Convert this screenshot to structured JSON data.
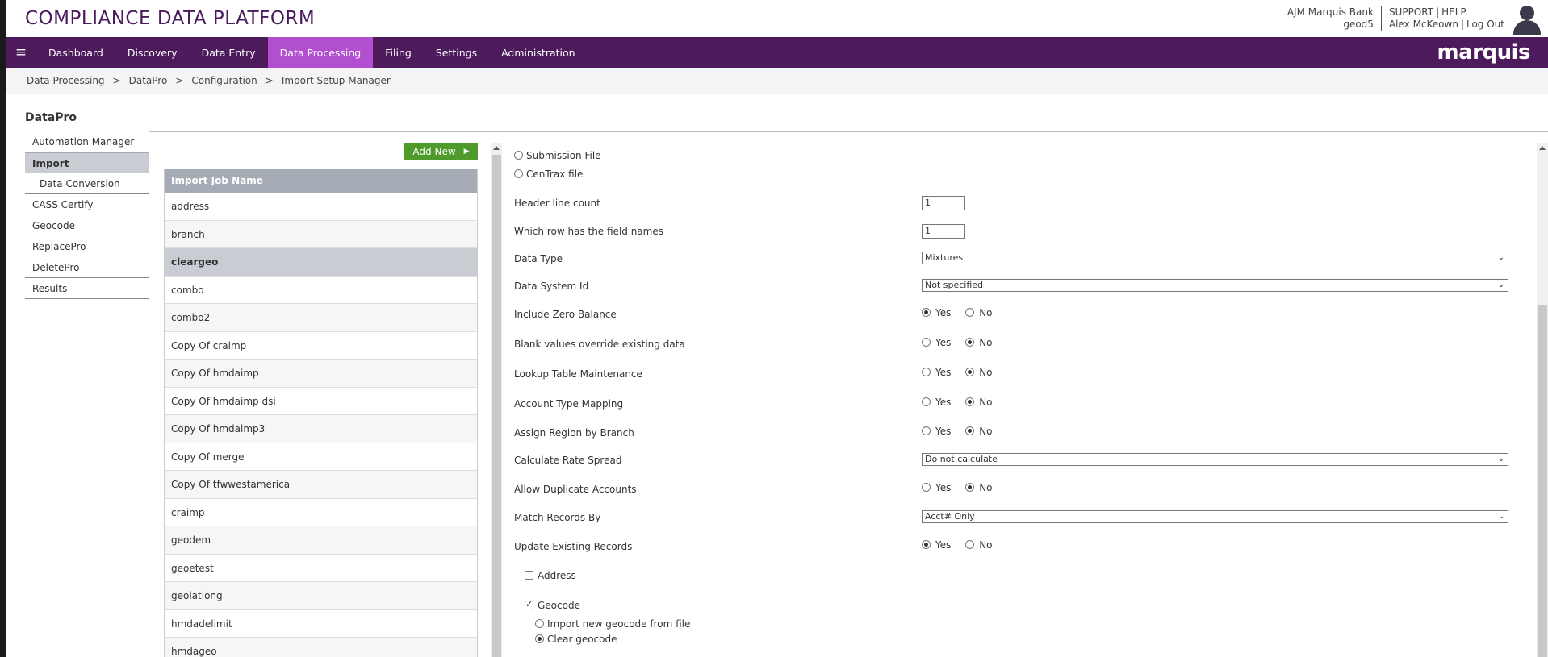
{
  "header": {
    "brand": "COMPLIANCE DATA PLATFORM",
    "bank_name": "AJM Marquis Bank",
    "user_code": "geod5",
    "support": "SUPPORT",
    "help": "HELP",
    "user_name": "Alex McKeown",
    "logout": "Log Out",
    "separator": "|"
  },
  "nav": {
    "menu_icon": "≡",
    "items": [
      "Dashboard",
      "Discovery",
      "Data Entry",
      "Data Processing",
      "Filing",
      "Settings",
      "Administration"
    ],
    "active": "Data Processing",
    "logo": "marquis"
  },
  "breadcrumb": {
    "items": [
      "Data Processing",
      "DataPro",
      "Configuration",
      "Import Setup Manager"
    ],
    "separator": ">"
  },
  "section_title": "DataPro",
  "side_menu": {
    "items": [
      "Automation Manager",
      "Import",
      "Data Conversion",
      "CASS Certify",
      "Geocode",
      "ReplacePro",
      "DeletePro",
      "Results"
    ],
    "active": "Import"
  },
  "job_list": {
    "add_new": "Add New",
    "header": "Import Job Name",
    "rows": [
      "address",
      "branch",
      "cleargeo",
      "combo",
      "combo2",
      "Copy Of craimp",
      "Copy Of hmdaimp",
      "Copy Of hmdaimp dsi",
      "Copy Of hmdaimp3",
      "Copy Of merge",
      "Copy Of tfwwestamerica",
      "craimp",
      "geodem",
      "geoetest",
      "geolatlong",
      "hmdadelimit",
      "hmdageo"
    ],
    "selected": "cleargeo"
  },
  "form": {
    "file_types": {
      "submission": "Submission File",
      "centrax": "CenTrax file"
    },
    "header_line_count": {
      "label": "Header line count",
      "value": "1"
    },
    "field_names_row": {
      "label": "Which row has the field names",
      "value": "1"
    },
    "data_type": {
      "label": "Data Type",
      "value": "Mixtures"
    },
    "data_system_id": {
      "label": "Data System Id",
      "value": "Not specified"
    },
    "include_zero_balance": {
      "label": "Include Zero Balance",
      "value": "Yes"
    },
    "blank_override": {
      "label": "Blank values override existing data",
      "value": "No"
    },
    "lookup_table": {
      "label": "Lookup Table Maintenance",
      "value": "No"
    },
    "account_type_mapping": {
      "label": "Account Type Mapping",
      "value": "No"
    },
    "assign_region": {
      "label": "Assign Region by Branch",
      "value": "No"
    },
    "rate_spread": {
      "label": "Calculate Rate Spread",
      "value": "Do not calculate"
    },
    "allow_duplicates": {
      "label": "Allow Duplicate Accounts",
      "value": "No"
    },
    "match_records": {
      "label": "Match Records By",
      "value": "Acct# Only"
    },
    "update_existing": {
      "label": "Update Existing Records",
      "value": "Yes"
    },
    "yes": "Yes",
    "no": "No",
    "address": {
      "label": "Address",
      "checked": false
    },
    "geocode": {
      "label": "Geocode",
      "checked": true
    },
    "geocode_import": "Import new geocode from file",
    "geocode_clear": "Clear geocode",
    "geocode_option": "Clear geocode"
  }
}
